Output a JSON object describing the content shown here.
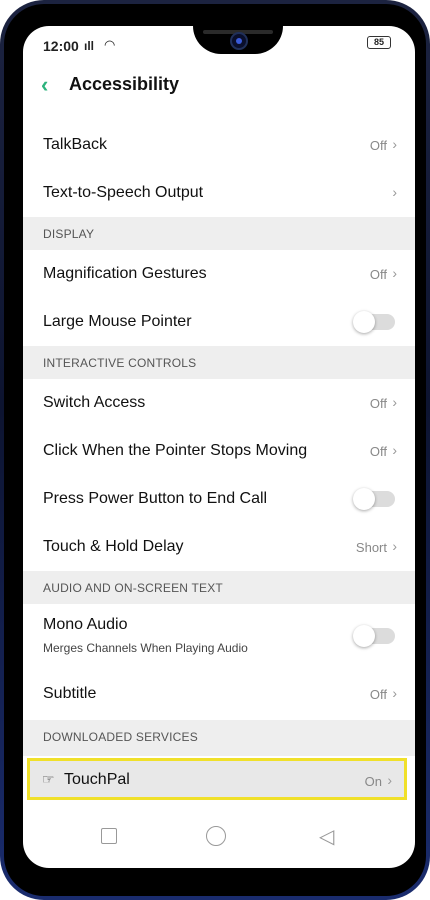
{
  "status_bar": {
    "time": "12:00",
    "battery": "85"
  },
  "header": {
    "title": "Accessibility"
  },
  "items": [
    {
      "label": "TalkBack",
      "status": "Off"
    },
    {
      "label": "Text-to-Speech Output",
      "status": ""
    }
  ],
  "sections": {
    "display": {
      "title": "DISPLAY",
      "magnification": {
        "label": "Magnification Gestures",
        "status": "Off"
      },
      "large_pointer": {
        "label": "Large Mouse Pointer"
      }
    },
    "interactive": {
      "title": "INTERACTIVE CONTROLS",
      "switch_access": {
        "label": "Switch Access",
        "status": "Off"
      },
      "click_pointer": {
        "label": "Click When the Pointer Stops Moving",
        "status": "Off"
      },
      "power_end_call": {
        "label": "Press Power Button to End Call"
      },
      "touch_hold": {
        "label": "Touch & Hold Delay",
        "status": "Short"
      }
    },
    "audio": {
      "title": "AUDIO AND ON-SCREEN TEXT",
      "mono_audio": {
        "label": "Mono Audio",
        "sub": "Merges Channels When Playing Audio"
      },
      "subtitle": {
        "label": "Subtitle",
        "status": "Off"
      }
    },
    "downloaded": {
      "title": "DOWNLOADED SERVICES",
      "touchpal": {
        "label": "TouchPal",
        "status": "On",
        "icon": "☞"
      }
    }
  },
  "chevron": "›",
  "icons": {
    "back": "‹",
    "signal": "ıll",
    "wifi": "◠",
    "nav_back": "◁"
  }
}
